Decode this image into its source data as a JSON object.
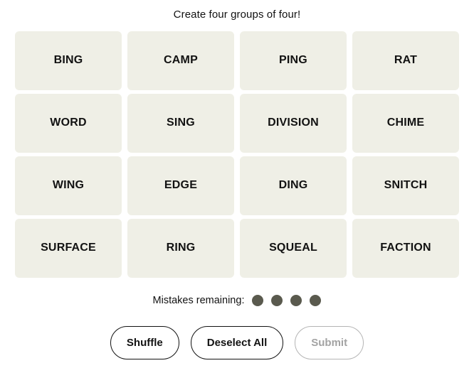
{
  "header": {
    "instruction": "Create four groups of four!"
  },
  "board": {
    "rows": [
      [
        "BING",
        "CAMP",
        "PING",
        "RAT"
      ],
      [
        "WORD",
        "SING",
        "DIVISION",
        "CHIME"
      ],
      [
        "WING",
        "EDGE",
        "DING",
        "SNITCH"
      ],
      [
        "SURFACE",
        "RING",
        "SQUEAL",
        "FACTION"
      ]
    ],
    "tile_color": "#efefe6",
    "tile_text_color": "#121212"
  },
  "mistakes": {
    "label": "Mistakes remaining:",
    "remaining": 4,
    "dot_color": "#5a5a4e"
  },
  "controls": {
    "shuffle_label": "Shuffle",
    "deselect_label": "Deselect All",
    "submit_label": "Submit",
    "submit_disabled": true
  }
}
